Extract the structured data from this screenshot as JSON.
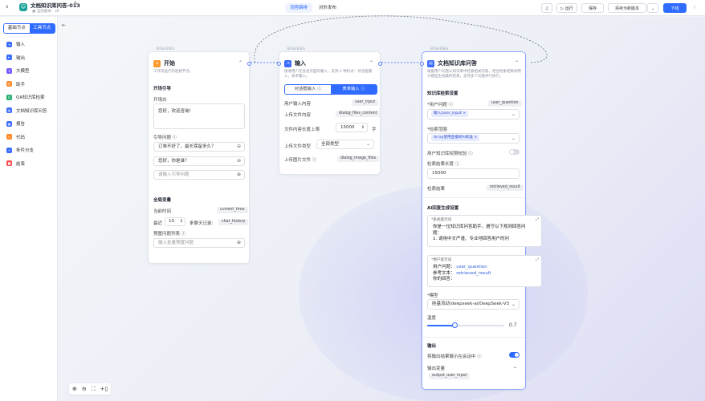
{
  "topbar": {
    "title": "文档知识库问答-013",
    "subtitle": "当前版本：v0",
    "app_icon": "robot-icon",
    "tabs": [
      {
        "label": "流程编排",
        "active": true
      },
      {
        "label": "对外发布",
        "active": false
      }
    ],
    "run_label": "运行",
    "save_label": "保存",
    "save_new_label": "另存为新版本",
    "publish_label": "下线"
  },
  "sidebar": {
    "tabs": [
      {
        "label": "基础节点",
        "active": false
      },
      {
        "label": "工具节点",
        "active": true
      }
    ],
    "items": [
      {
        "label": "输入",
        "color": "#3b6cff"
      },
      {
        "label": "输出",
        "color": "#3b6cff"
      },
      {
        "label": "大模型",
        "color": "#7a5cff"
      },
      {
        "label": "助手",
        "color": "#ff8a2a"
      },
      {
        "label": "QA知识库检索",
        "color": "#1fae6b"
      },
      {
        "label": "文档知识库问答",
        "color": "#3b6cff"
      },
      {
        "label": "报告",
        "color": "#3b6cff"
      },
      {
        "label": "代码",
        "color": "#ff8a2a"
      },
      {
        "label": "条件分支",
        "color": "#3b6cff"
      },
      {
        "label": "结束",
        "color": "#ff4d4f"
      }
    ]
  },
  "start_node": {
    "brand": "BISHENG",
    "title": "开始",
    "desc": "工作流运行的起始节点。",
    "opening_section": "开场引导",
    "opening_label": "开场白",
    "opening_text": "您好，欢迎咨询！",
    "guide_label": "引导问题",
    "guide_questions": [
      "订单不好了，最长保留多久？",
      "您好，你是谁？"
    ],
    "guide_placeholder": "请输入引导问题",
    "global_section": "全局变量",
    "current_time_label": "当前时间",
    "current_time_var": "current_time",
    "history_prefix": "最近",
    "history_count": "10",
    "history_suffix": "条聊天记录:",
    "history_var": "chat_history",
    "preset_label": "预置问题列表",
    "preset_placeholder": "输入批量预置问题"
  },
  "input_node": {
    "brand": "BISHENG",
    "title": "输入",
    "desc": "接收用户在会话页面的输入，支持 2 种形式：对话框输入，表单输入。",
    "mode_tabs": [
      {
        "label": "对话框输入",
        "active": false
      },
      {
        "label": "表单输入",
        "active": true
      }
    ],
    "rows": [
      {
        "label": "用户输入内容",
        "var": "user_input"
      },
      {
        "label": "上传文件内容",
        "var": "dialog_files_content"
      }
    ],
    "length_label": "文件内容长度上限",
    "length_value": "15000",
    "length_unit": "字",
    "filetype_label": "上传文件类型",
    "filetype_value": "全部类型",
    "image_label": "上传图片文件",
    "image_var": "dialog_image_files"
  },
  "rag_node": {
    "brand": "BISHENG",
    "title": "文档知识库问答",
    "desc": "根据用户问题从知识库中检索相关内容，结合检索结果调用大模型生成最终结果，支持多个问题并行执行。",
    "retrieval_section": "知识库检索设置",
    "question_label": "*用户问题",
    "question_var": "user_question",
    "question_chip": "输入/user_input",
    "scope_label": "*检索范围",
    "scope_chip": "Array使用直播间AI标准",
    "permission_label": "用户知识库权限校验",
    "result_len_label": "检索结果长度",
    "result_len_value": "15000",
    "result_label": "检索结果",
    "result_var": "retrieved_result",
    "ai_section": "AI回复生成设置",
    "system_prompt_label": "*系统提示词",
    "system_prompt_lines": [
      "你是一位知识库问答助手，遵守以下规则回答问题：",
      "1. 请用中文严谨、专业地回答用户的问"
    ],
    "user_prompt_label": "*用户提示词",
    "user_prompt_q_prefix": "用户问题：",
    "user_prompt_q_var": "user_question",
    "user_prompt_ref_prefix": "参考文本：",
    "user_prompt_ref_var": "retrieved_result",
    "user_prompt_answer": "你的回答：",
    "model_label": "*模型",
    "model_value": "硅基流动/deepseek-ai/DeepSeek-V3",
    "temp_label": "温度",
    "temp_value": "0.7",
    "temp_fraction": 0.7,
    "output_section": "输出",
    "show_result_label": "将输出结果展示在会话中",
    "output_var_label": "输出变量",
    "output_var": "output_user_input"
  }
}
